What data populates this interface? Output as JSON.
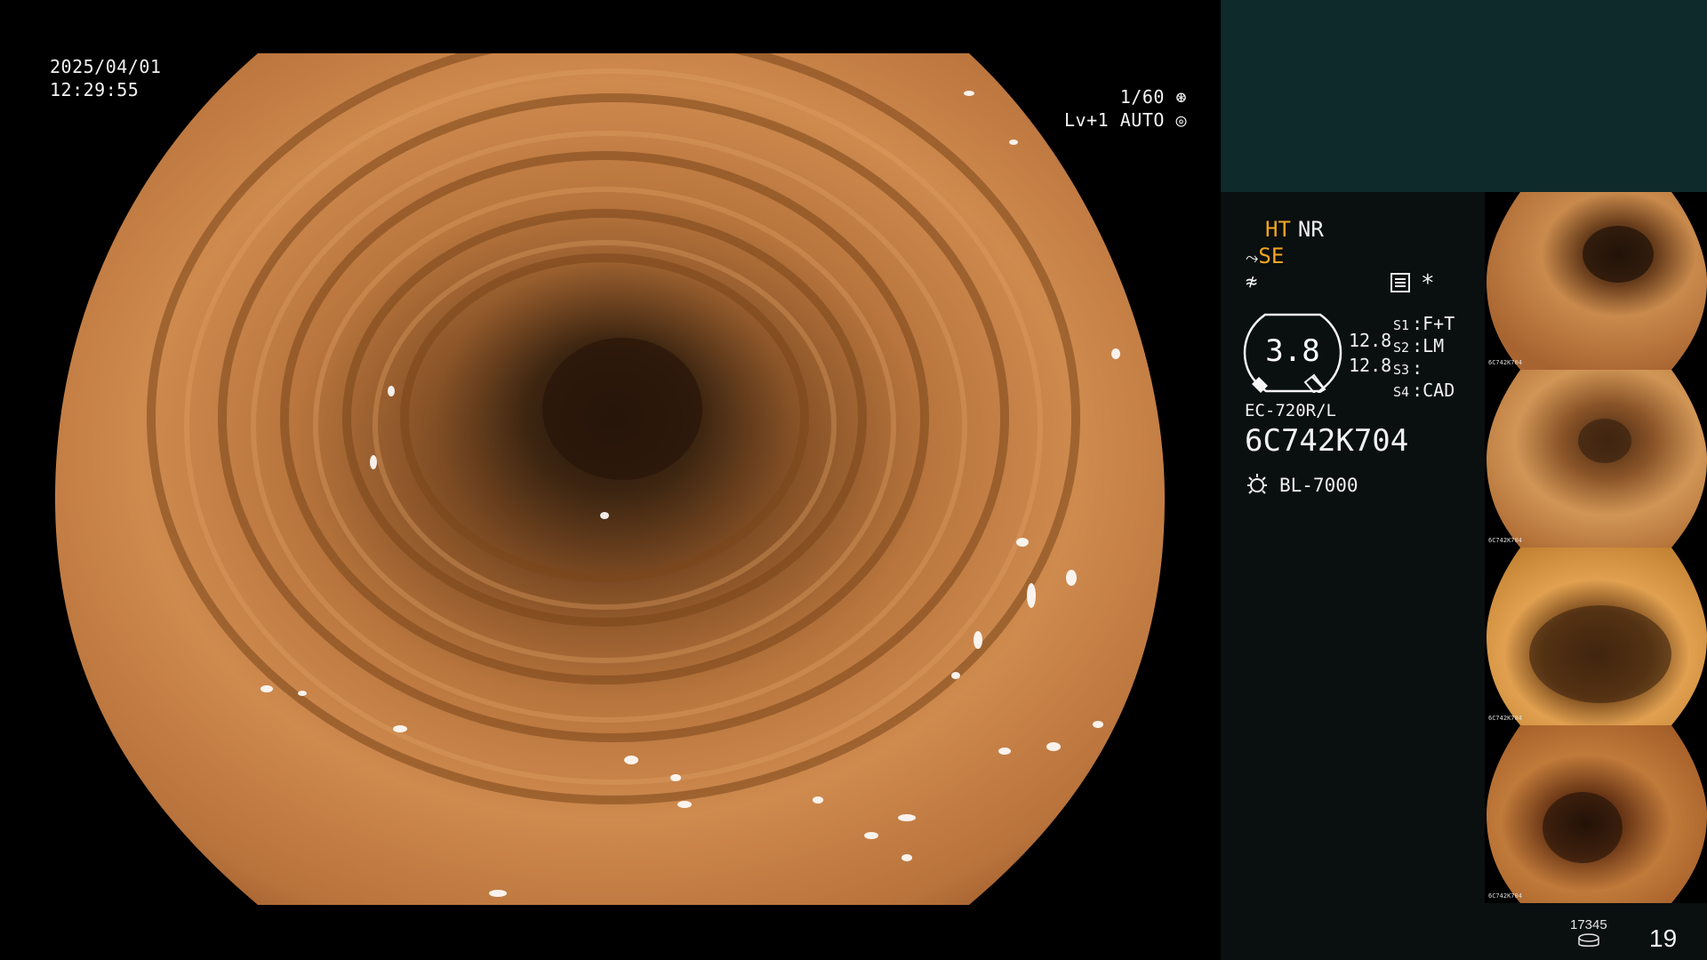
{
  "overlay": {
    "date": "2025/04/01",
    "time": "12:29:55",
    "shutter": "1/60",
    "level": "Lv+1",
    "exposure_mode": "AUTO",
    "shutter_icon": "aperture-icon",
    "exposure_icon": "iris-icon"
  },
  "panel": {
    "mode_ht": "HT",
    "mode_nr": "NR",
    "mode_se": "SE",
    "sym_row": "≉",
    "gauge_value": "3.8",
    "val1": "12.8",
    "val2": "12.8",
    "switches": [
      {
        "key": "S1",
        "value": "F+T"
      },
      {
        "key": "S2",
        "value": "LM"
      },
      {
        "key": "S3",
        "value": ""
      },
      {
        "key": "S4",
        "value": "CAD"
      }
    ],
    "asterisk": "*",
    "scope_model": "EC-720R/L",
    "scope_serial": "6C742K704",
    "light_source": "BL-7000"
  },
  "counters": {
    "small": "17345",
    "big": "19"
  },
  "colors": {
    "panel_top": "#0f2a2a",
    "panel_bg": "#0a0f0f",
    "accent": "#f5a623"
  },
  "thumbnails": [
    {
      "label": "6C742K704"
    },
    {
      "label": "6C742K704"
    },
    {
      "label": "6C742K704"
    },
    {
      "label": "6C742K704"
    }
  ]
}
